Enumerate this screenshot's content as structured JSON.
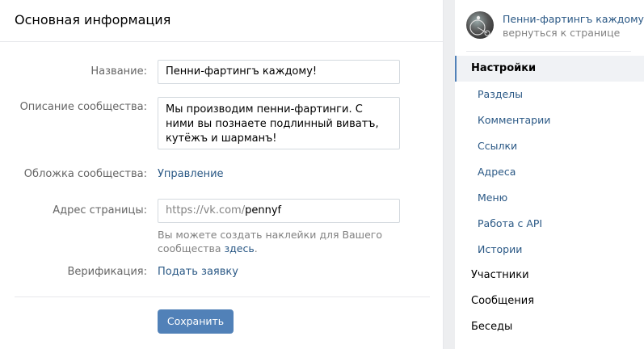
{
  "header": {
    "title": "Основная информация"
  },
  "form": {
    "name": {
      "label": "Название:",
      "value": "Пенни-фартингъ каждому!"
    },
    "description": {
      "label": "Описание сообщества:",
      "value": "Мы производим пенни-фартинги. С ними вы познаете подлинный виватъ, кутёжъ и шарманъ!"
    },
    "cover": {
      "label": "Обложка сообщества:",
      "link": "Управление"
    },
    "address": {
      "label": "Адрес страницы:",
      "prefix": "https://vk.com/",
      "value": "pennyf",
      "hint_text": "Вы можете создать наклейки для Вашего сообщества",
      "hint_link": "здесь",
      "hint_end": "."
    },
    "verification": {
      "label": "Верификация:",
      "link": "Подать заявку"
    },
    "save_label": "Сохранить"
  },
  "sidebar": {
    "community_name": "Пенни-фартингъ каждому!",
    "back_link": "вернуться к странице",
    "items": [
      {
        "label": "Настройки",
        "type": "main",
        "active": true
      },
      {
        "label": "Разделы",
        "type": "sub"
      },
      {
        "label": "Комментарии",
        "type": "sub"
      },
      {
        "label": "Ссылки",
        "type": "sub"
      },
      {
        "label": "Адреса",
        "type": "sub"
      },
      {
        "label": "Меню",
        "type": "sub"
      },
      {
        "label": "Работа с API",
        "type": "sub"
      },
      {
        "label": "Истории",
        "type": "sub"
      },
      {
        "label": "Участники",
        "type": "main"
      },
      {
        "label": "Сообщения",
        "type": "main"
      },
      {
        "label": "Беседы",
        "type": "main"
      }
    ]
  },
  "colors": {
    "accent": "#5181b8",
    "link": "#2a5885",
    "muted": "#828282",
    "background": "#edeef0"
  }
}
